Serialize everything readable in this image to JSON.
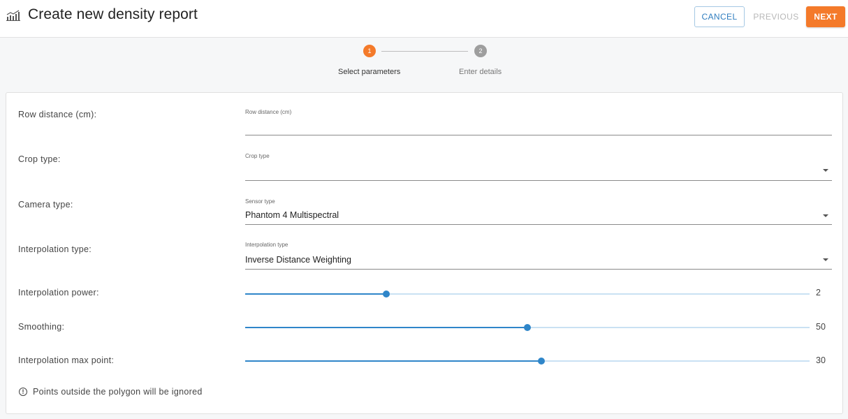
{
  "header": {
    "title": "Create new density report",
    "icon": "chart-bars-icon",
    "cancel_label": "CANCEL",
    "previous_label": "PREVIOUS",
    "next_label": "NEXT",
    "accent_color": "#f47a2a",
    "primary_color": "#2f7dbf"
  },
  "stepper": {
    "steps": [
      {
        "number": "1",
        "label": "Select parameters",
        "state": "active"
      },
      {
        "number": "2",
        "label": "Enter details",
        "state": "inactive"
      }
    ]
  },
  "form": {
    "row_distance": {
      "label": "Row distance (cm):",
      "field_label": "Row distance (cm)",
      "value": ""
    },
    "crop_type": {
      "label": "Crop type:",
      "field_label": "Crop type",
      "value": ""
    },
    "camera_type": {
      "label": "Camera type:",
      "field_label": "Sensor type",
      "value": "Phantom 4 Multispectral"
    },
    "interpolation_type": {
      "label": "Interpolation type:",
      "field_label": "Interpolation type",
      "value": "Inverse Distance Weighting"
    },
    "interpolation_power": {
      "label": "Interpolation power:",
      "value": "2",
      "fraction": 0.25
    },
    "smoothing": {
      "label": "Smoothing:",
      "value": "50",
      "fraction": 0.5
    },
    "interpolation_max_point": {
      "label": "Interpolation max point:",
      "value": "30",
      "fraction": 0.525
    }
  },
  "notice": {
    "icon": "info-icon",
    "text": "Points outside the polygon will be ignored"
  }
}
